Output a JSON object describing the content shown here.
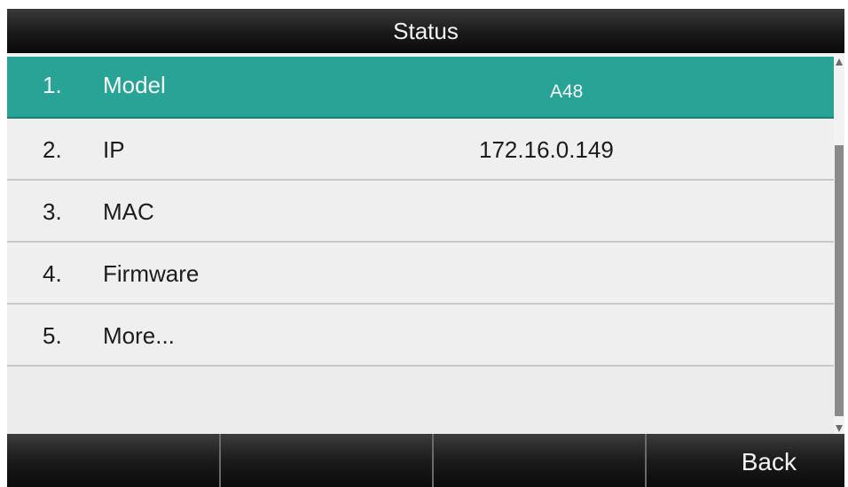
{
  "header": {
    "title": "Status"
  },
  "menu": {
    "items": [
      {
        "number": "1.",
        "label": "Model",
        "value": "A48",
        "selected": true
      },
      {
        "number": "2.",
        "label": "IP",
        "value": "172.16.0.149",
        "selected": false
      },
      {
        "number": "3.",
        "label": "MAC",
        "value": "",
        "selected": false
      },
      {
        "number": "4.",
        "label": "Firmware",
        "value": "",
        "selected": false
      },
      {
        "number": "5.",
        "label": "More...",
        "value": "",
        "selected": false
      }
    ]
  },
  "softkeys": {
    "key1": "",
    "key2": "",
    "key3": "",
    "key4": "Back"
  },
  "colors": {
    "selection": "#2aa397",
    "title_bar": "#1a1a1a",
    "row_background": "#efefef"
  }
}
